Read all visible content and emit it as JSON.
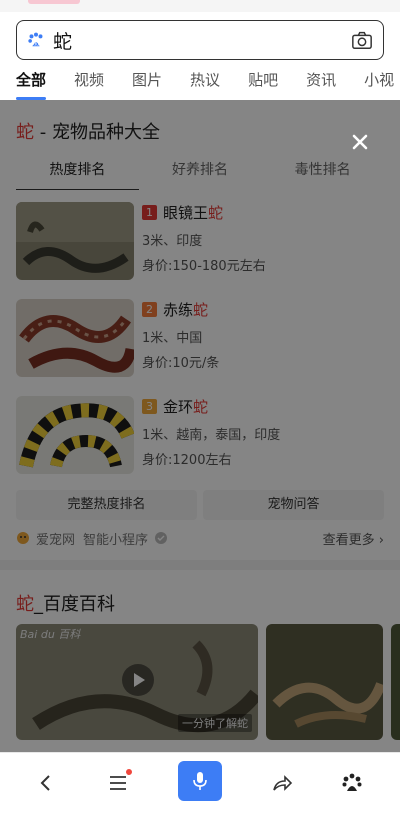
{
  "search": {
    "query": "蛇"
  },
  "tabs": [
    "全部",
    "视频",
    "图片",
    "热议",
    "贴吧",
    "资讯",
    "小视"
  ],
  "pet_card": {
    "title_keyword": "蛇",
    "title_rest": " - 宠物品种大全",
    "subtabs": [
      "热度排名",
      "好养排名",
      "毒性排名"
    ],
    "items": [
      {
        "rank": "1",
        "rank_color": "#e53935",
        "name_prefix": "眼镜王",
        "name_keyword": "蛇",
        "meta": "3米、印度",
        "price": "身价:150-180元左右"
      },
      {
        "rank": "2",
        "rank_color": "#f57c3a",
        "name_prefix": "赤练",
        "name_keyword": "蛇",
        "meta": "1米、中国",
        "price": "身价:10元/条"
      },
      {
        "rank": "3",
        "rank_color": "#f2a93b",
        "name_prefix": "金环",
        "name_keyword": "蛇",
        "meta": "1米、越南，泰国，印度",
        "price": "身价:1200左右"
      }
    ],
    "buttons": [
      "完整热度排名",
      "宠物问答"
    ],
    "source": {
      "name": "爱宠网",
      "type": "智能小程序",
      "more": "查看更多"
    }
  },
  "baike": {
    "title_keyword": "蛇",
    "title_rest": "_百度百科",
    "video_watermark": "Bai du 百科",
    "video_caption": "一分钟了解蛇"
  },
  "colors": {
    "accent": "#3d7df5",
    "keyword": "#e53935"
  },
  "bottom_nav": [
    "back-icon",
    "menu-icon",
    "mic-icon",
    "share-icon",
    "baidu-paw-icon"
  ]
}
